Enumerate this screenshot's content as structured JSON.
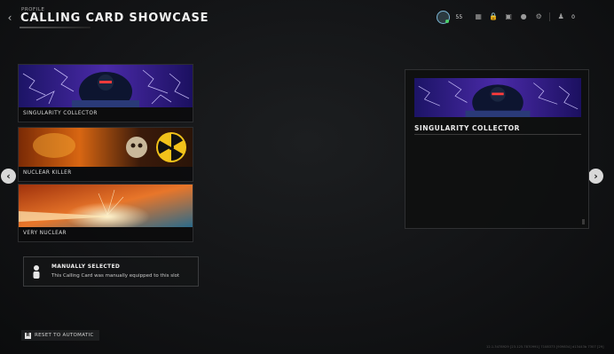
{
  "header": {
    "breadcrumb": "PROFILE",
    "title": "CALLING CARD SHOWCASE"
  },
  "topbar": {
    "player_level": "55",
    "currency_count": "0",
    "icons": [
      "avatar-icon",
      "grid-icon",
      "lock-icon",
      "card-icon",
      "bell-icon",
      "gear-icon",
      "people-icon"
    ]
  },
  "cards": [
    {
      "label": "SINGULARITY COLLECTOR",
      "art": "purple-lightning-soldier"
    },
    {
      "label": "NUCLEAR KILLER",
      "art": "fire-skull-radiation-symbol"
    },
    {
      "label": "VERY NUCLEAR",
      "art": "orange-blast-flare"
    }
  ],
  "info": {
    "title": "MANUALLY SELECTED",
    "description": "This Calling Card was manually equipped to this slot"
  },
  "reset": {
    "key": "R",
    "label": "RESET TO AUTOMATIC"
  },
  "preview": {
    "title": "SINGULARITY COLLECTOR"
  },
  "build_string": "12.1.3478929 [23.125.7870991] 7108373 [939834] d13443b 7307 [29]",
  "colors": {
    "accent_ring": "#7bb7d6",
    "online": "#4bd06a",
    "text": "#d8d8d8"
  }
}
